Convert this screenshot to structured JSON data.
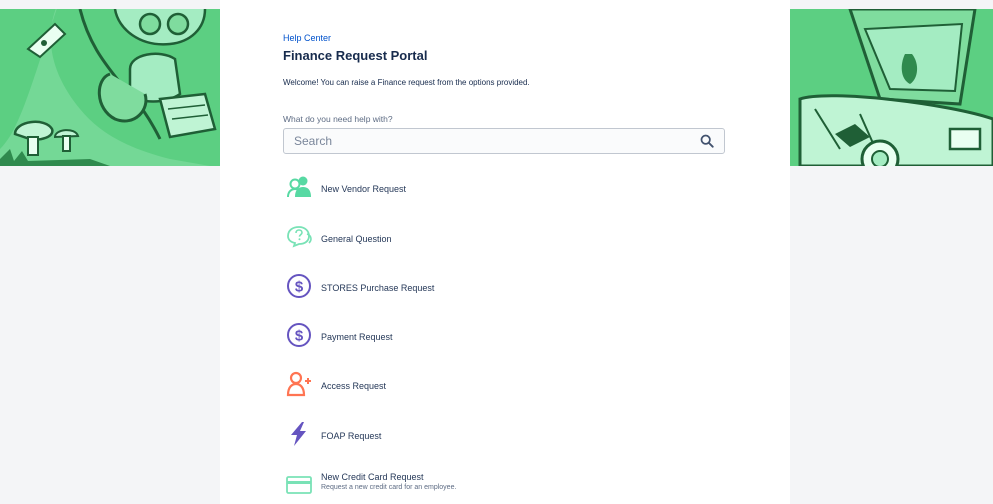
{
  "header": {
    "breadcrumb": "Help Center",
    "title": "Finance Request Portal",
    "welcome": "Welcome! You can raise a Finance request from the options provided."
  },
  "search": {
    "label": "What do you need help with?",
    "placeholder": "Search",
    "value": ""
  },
  "request_types": [
    {
      "label": "New Vendor Request",
      "icon": "new-vendor-icon",
      "color": "#57d9a3"
    },
    {
      "label": "General Question",
      "icon": "question-bubble-icon",
      "color": "#79e2b6"
    },
    {
      "label": "STORES Purchase Request",
      "icon": "dollar-icon",
      "color": "#6554c0"
    },
    {
      "label": "Payment Request",
      "icon": "dollar-icon",
      "color": "#6554c0"
    },
    {
      "label": "Access Request",
      "icon": "add-person-icon",
      "color": "#ff7452"
    },
    {
      "label": "FOAP Request",
      "icon": "lightning-icon",
      "color": "#6554c0"
    },
    {
      "label": "New Credit Card Request",
      "description": "Request a new credit card for an employee.",
      "icon": "credit-card-icon",
      "color": "#79e2b6"
    }
  ],
  "colors": {
    "banner": "#55c97c",
    "banner_light": "#a4ecc2",
    "banner_dark": "#1f5f36",
    "link": "#0052cc"
  }
}
